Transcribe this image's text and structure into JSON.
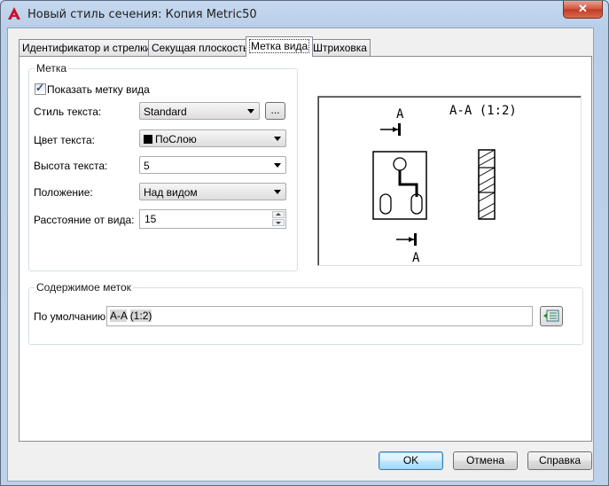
{
  "window": {
    "title": "Новый стиль сечения: Копия Metric50",
    "close_glyph": "✕"
  },
  "tabs": [
    {
      "label": "Идентификатор и стрелки",
      "active": false
    },
    {
      "label": "Секущая плоскость",
      "active": false
    },
    {
      "label": "Метка вида",
      "active": true
    },
    {
      "label": "Штриховка",
      "active": false
    }
  ],
  "label_group": {
    "title": "Метка",
    "show_label": {
      "label": "Показать метку вида",
      "checked": true
    },
    "text_style": {
      "label": "Стиль текста:",
      "value": "Standard",
      "browse_label": "..."
    },
    "text_color": {
      "label": "Цвет текста:",
      "value": "ПоСлою",
      "swatch_color": "#000000"
    },
    "text_height": {
      "label": "Высота текста:",
      "value": "5"
    },
    "position": {
      "label": "Положение:",
      "value": "Над видом"
    },
    "offset": {
      "label": "Расстояние от вида:",
      "value": "15"
    }
  },
  "preview": {
    "title_text": "A-A (1:2)",
    "top_letter": "A",
    "bottom_letter": "A"
  },
  "contents_group": {
    "title": "Содержимое меток",
    "default_label": "По умолчанию:",
    "field_part1": "A-A",
    "field_part2": " ",
    "field_part3": "(1:2)",
    "insert_field_icon": "insert-field-icon"
  },
  "buttons": {
    "ok": "OK",
    "cancel": "Отмена",
    "help": "Справка"
  }
}
